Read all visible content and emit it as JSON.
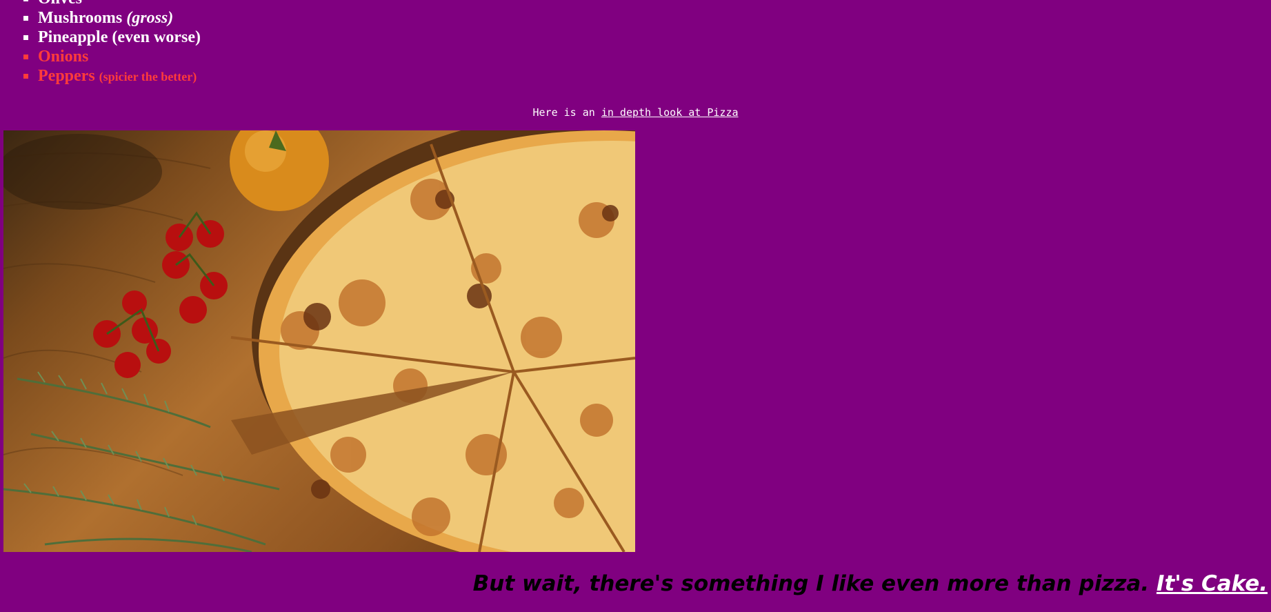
{
  "toppings": [
    {
      "label": "Olives",
      "note": "",
      "color": "white"
    },
    {
      "label": "Mushrooms ",
      "note": "(gross)",
      "color": "white"
    },
    {
      "label": "Pineapple (even worse)",
      "note": "",
      "color": "white"
    },
    {
      "label": "Onions",
      "note": "",
      "color": "red"
    },
    {
      "label": "Peppers ",
      "note": "(spicier the better)",
      "color": "red"
    }
  ],
  "intro": {
    "text": "Here is an ",
    "link_label": "in depth look at Pizza"
  },
  "tagline": {
    "text": "But wait, there's something I like even more than pizza. ",
    "link_label": "It's Cake."
  },
  "colors": {
    "background": "#800080",
    "accent_red": "#ff3b3b",
    "text_white": "#ffffff",
    "text_black": "#000000"
  }
}
